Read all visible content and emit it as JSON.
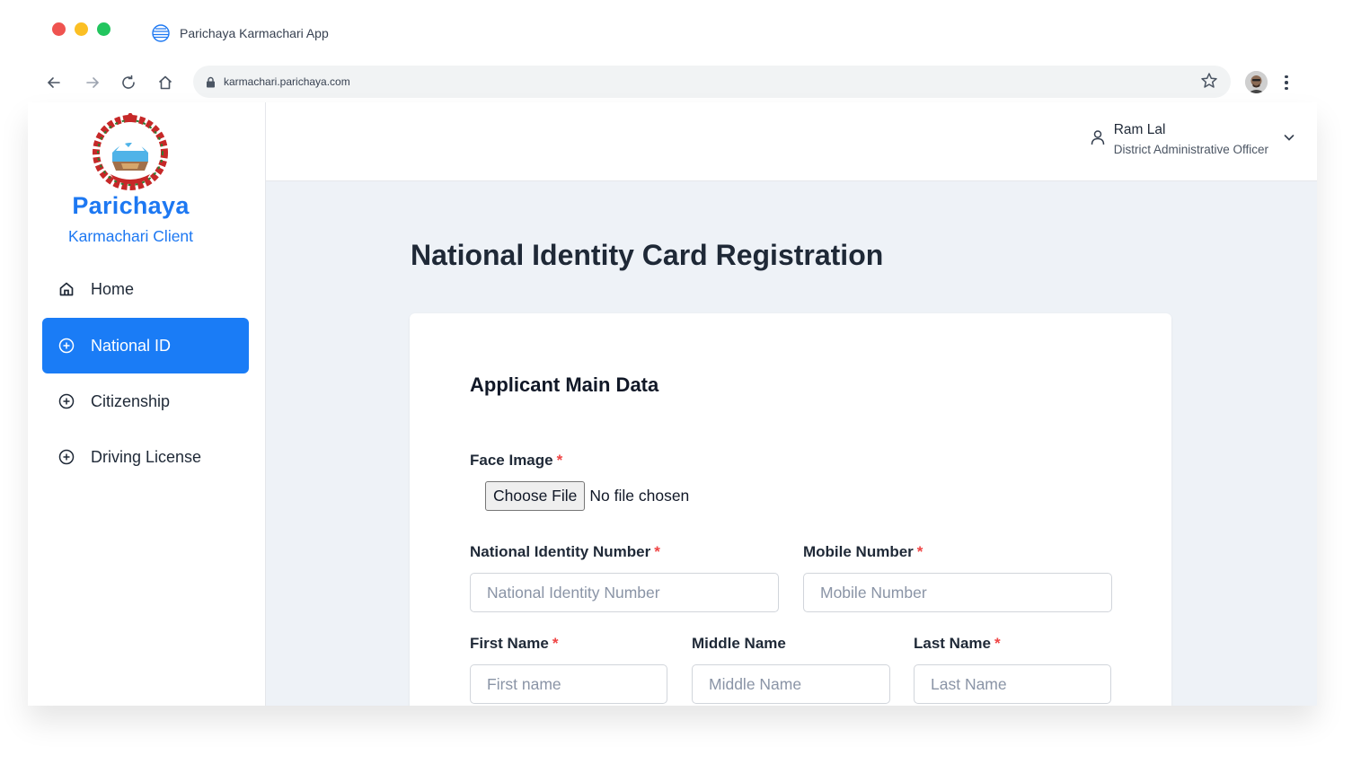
{
  "browser": {
    "tab_title": "Parichaya Karmachari App",
    "url": "karmachari.parichaya.com"
  },
  "sidebar": {
    "brand_title": "Parichaya",
    "brand_subtitle": "Karmachari Client",
    "items": [
      {
        "label": "Home",
        "icon": "home-icon",
        "active": false
      },
      {
        "label": "National ID",
        "icon": "plus-circle-icon",
        "active": true
      },
      {
        "label": "Citizenship",
        "icon": "plus-circle-icon",
        "active": false
      },
      {
        "label": "Driving License",
        "icon": "plus-circle-icon",
        "active": false
      }
    ]
  },
  "header": {
    "user_name": "Ram Lal",
    "user_role": "District Administrative Officer"
  },
  "main": {
    "page_title": "National Identity Card Registration",
    "section_title": "Applicant Main Data",
    "face_image": {
      "label": "Face Image",
      "required_mark": "*",
      "button": "Choose File",
      "status": "No file chosen"
    },
    "fields": {
      "nin": {
        "label": "National Identity Number",
        "required_mark": "*",
        "placeholder": "National Identity Number"
      },
      "mobile": {
        "label": "Mobile Number",
        "required_mark": "*",
        "placeholder": "Mobile Number"
      },
      "first": {
        "label": "First Name",
        "required_mark": "*",
        "placeholder": "First name"
      },
      "middle": {
        "label": "Middle Name",
        "placeholder": "Middle Name"
      },
      "last": {
        "label": "Last Name",
        "required_mark": "*",
        "placeholder": "Last Name"
      }
    }
  },
  "colors": {
    "accent": "#1a7cf6",
    "brand": "#1d78f2",
    "required": "#ef4444",
    "content_bg": "#eef2f7"
  }
}
